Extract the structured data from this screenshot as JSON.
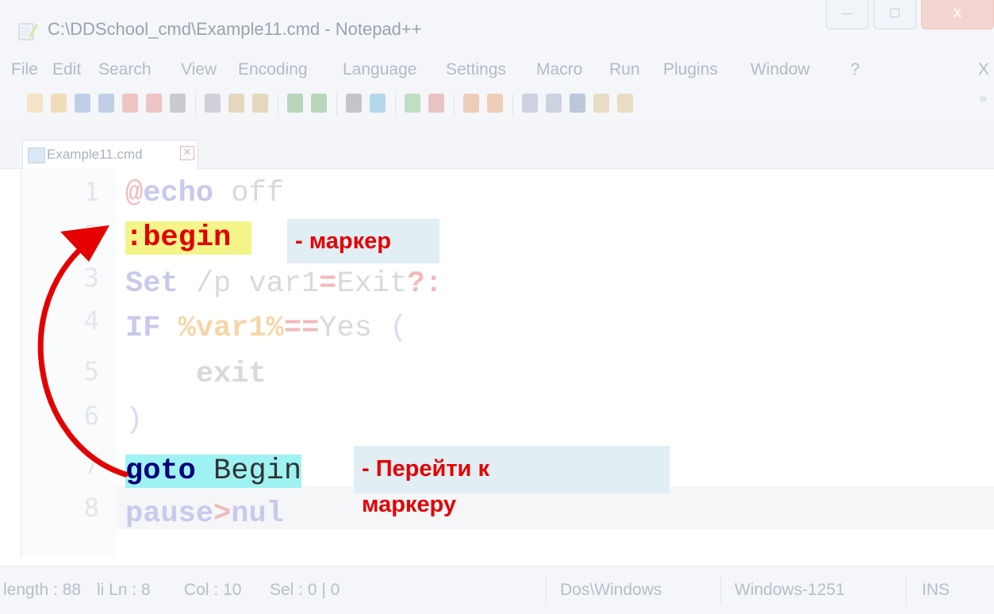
{
  "window": {
    "title": "C:\\DDSchool_cmd\\Example11.cmd - Notepad++",
    "minimize_glyph": "—",
    "maximize_glyph": "☐",
    "close_glyph": "X"
  },
  "menu": [
    "File",
    "Edit",
    "Search",
    "View",
    "Encoding",
    "Language",
    "Settings",
    "Macro",
    "Run",
    "Plugins",
    "Window",
    "?"
  ],
  "menu_close": "X",
  "toolbar_more": "»",
  "tab": {
    "label": "Example11.cmd",
    "close_glyph": "✕"
  },
  "editor": {
    "line_numbers": [
      "1",
      "2",
      "3",
      "4",
      "5",
      "6",
      "7",
      "8"
    ],
    "lines": [
      {
        "segments": [
          [
            "@",
            "#f2b9b9",
            false
          ],
          [
            "echo",
            "#c9c9ec",
            true
          ],
          [
            " off",
            "#d9d9d9",
            false
          ]
        ]
      },
      {
        "segments": [
          [
            ":begin",
            "#e00000",
            true
          ]
        ]
      },
      {
        "segments": [
          [
            "Set",
            "#c9c9ec",
            true
          ],
          [
            " /p var1",
            "#d9d9d9",
            false
          ],
          [
            "=",
            "#f2b9b9",
            true
          ],
          [
            "Exit",
            "#d9d9d9",
            false
          ],
          [
            "?:",
            "#f2b9b9",
            true
          ]
        ]
      },
      {
        "segments": [
          [
            "IF",
            "#c9c9ec",
            true
          ],
          [
            " ",
            "#d9d9d9",
            false
          ],
          [
            "%var1%",
            "#f6d6a6",
            true
          ],
          [
            "==",
            "#f2b9b9",
            true
          ],
          [
            "Yes",
            "#d9d9d9",
            false
          ],
          [
            " (",
            "#d6dcf2",
            false
          ]
        ]
      },
      {
        "segments": [
          [
            "    ",
            "#d9d9d9",
            false
          ],
          [
            "exit",
            "#d9d9d9",
            true
          ]
        ]
      },
      {
        "segments": [
          [
            ")",
            "#d6dcf2",
            false
          ]
        ]
      },
      {
        "segments": [
          [
            "goto",
            "#00007a",
            true
          ],
          [
            " Begin",
            "#333333",
            false
          ]
        ]
      },
      {
        "segments": [
          [
            "pause",
            "#c9c9ec",
            true
          ],
          [
            ">",
            "#f2b9b9",
            true
          ],
          [
            "nul",
            "#c9c9ec",
            true
          ]
        ]
      }
    ]
  },
  "callouts": {
    "marker": "- маркер",
    "goto_line1": "- Перейти к",
    "goto_line2": "маркеру"
  },
  "status": {
    "length": "length : 88",
    "lines": "li Ln : 8",
    "col": "Col : 10",
    "sel": "Sel : 0 | 0",
    "eol": "Dos\\Windows",
    "encoding": "Windows-1251",
    "mode": "INS"
  },
  "colors": {
    "callout_text": "#e40000",
    "arrow": "#e40000",
    "begin_highlight": "#f4f488",
    "goto_highlight": "#9ff2f2"
  }
}
